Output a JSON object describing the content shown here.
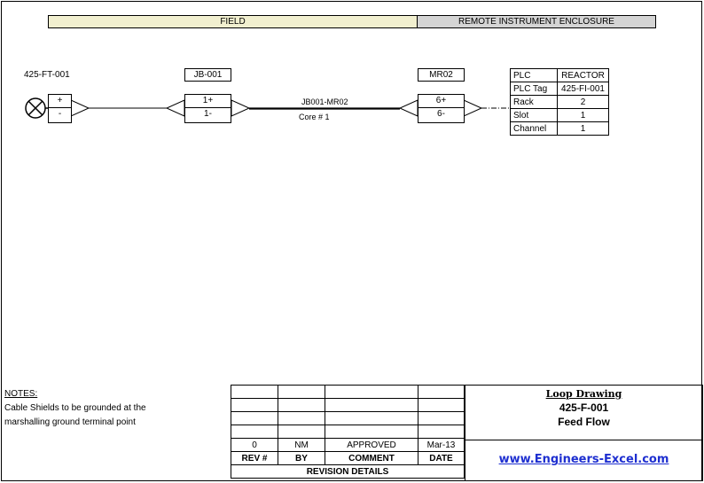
{
  "header": {
    "field": "FIELD",
    "remote_enclosure": "REMOTE INSTRUMENT ENCLOSURE"
  },
  "instrument": {
    "tag": "425-FT-001",
    "terminals": [
      "+",
      "-"
    ]
  },
  "junction_box": {
    "tag": "JB-001",
    "terminals": [
      "1+",
      "1-"
    ]
  },
  "cable": {
    "tag": "JB001-MR02",
    "core": "Core # 1"
  },
  "marshalling": {
    "tag": "MR02",
    "terminals": [
      "6+",
      "6-"
    ]
  },
  "plc": {
    "rows": [
      {
        "key": "PLC",
        "value": "REACTOR"
      },
      {
        "key": "PLC Tag",
        "value": "425-FI-001"
      },
      {
        "key": "Rack",
        "value": "2"
      },
      {
        "key": "Slot",
        "value": "1"
      },
      {
        "key": "Channel",
        "value": "1"
      }
    ]
  },
  "notes": {
    "heading": "NOTES:",
    "line1": "Cable Shields to be grounded at the",
    "line2": "marshalling ground terminal point"
  },
  "revisions": {
    "row": {
      "rev": "0",
      "by": "NM",
      "comment": "APPROVED",
      "date": "Mar-13"
    },
    "headers": {
      "rev": "REV #",
      "by": "BY",
      "comment": "COMMENT",
      "date": "DATE"
    },
    "footer": "REVISION DETAILS"
  },
  "title_block": {
    "drawing_type": "Loop Drawing",
    "loop_number": "425-F-001",
    "description": "Feed Flow",
    "website": "www.Engineers-Excel.com"
  }
}
